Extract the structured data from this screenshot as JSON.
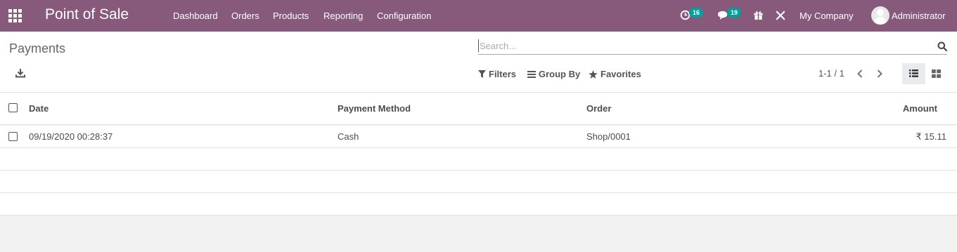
{
  "navbar": {
    "app_title": "Point of Sale",
    "menu": [
      "Dashboard",
      "Orders",
      "Products",
      "Reporting",
      "Configuration"
    ],
    "activity_count": "16",
    "messages_count": "19",
    "company": "My Company",
    "user": "Administrator",
    "brand_color": "#875a7b",
    "badge_color": "#00a09d"
  },
  "control_panel": {
    "title": "Payments",
    "search_placeholder": "Search...",
    "filters_label": "Filters",
    "group_by_label": "Group By",
    "favorites_label": "Favorites",
    "pager": "1-1 / 1"
  },
  "table": {
    "columns": {
      "date": "Date",
      "payment_method": "Payment Method",
      "order": "Order",
      "amount": "Amount"
    },
    "rows": [
      {
        "date": "09/19/2020 00:28:37",
        "payment_method": "Cash",
        "order": "Shop/0001",
        "amount": "₹ 15.11"
      }
    ]
  }
}
